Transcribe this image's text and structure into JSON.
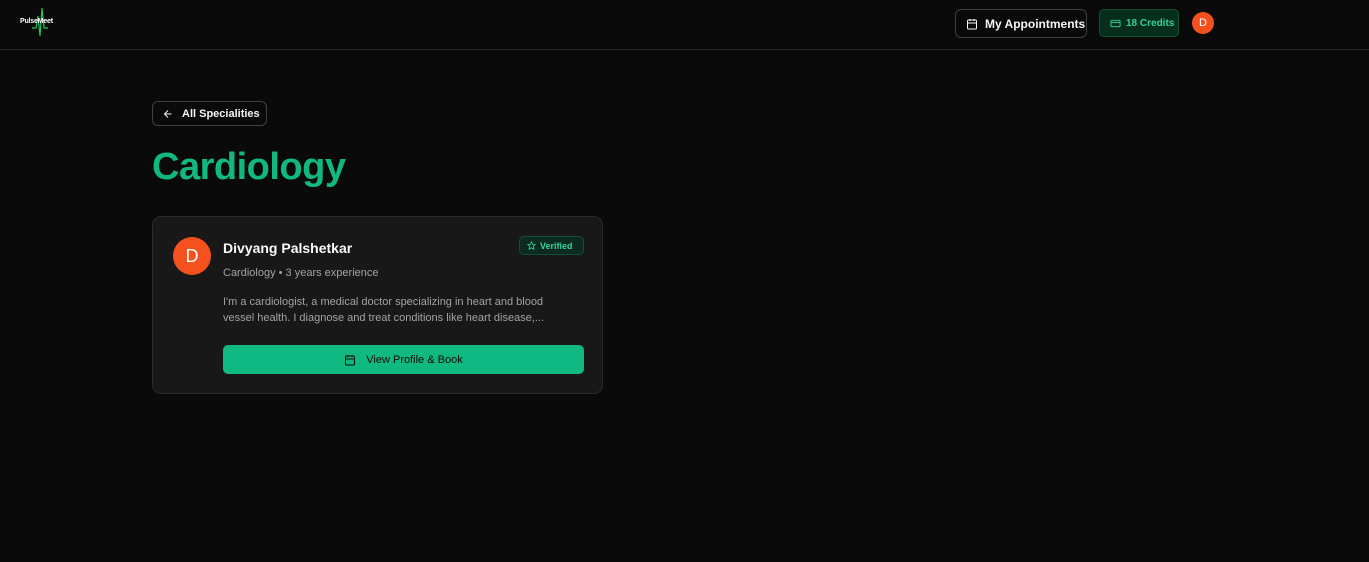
{
  "header": {
    "logo_text": "PulseMeet",
    "appointments_label": "My Appointments",
    "credits_label": "18 Credits",
    "user_initial": "D"
  },
  "nav": {
    "back_label": "All Specialities"
  },
  "page": {
    "title": "Cardiology"
  },
  "doctors": [
    {
      "initial": "D",
      "name": "Divyang Palshetkar",
      "badge": "Verified",
      "meta": "Cardiology • 3 years experience",
      "bio": "I'm a cardiologist, a medical doctor specializing in heart and blood vessel health. I diagnose and treat conditions like heart disease,...",
      "action_label": "View Profile & Book"
    }
  ],
  "colors": {
    "accent": "#10b981",
    "avatar": "#f4511e",
    "background": "#0a0a0a",
    "card": "#181818"
  },
  "icons": {
    "appointments": "calendar-icon",
    "credits": "credit-card-icon",
    "back": "arrow-left-icon",
    "verified": "star-icon",
    "book": "calendar-icon"
  }
}
